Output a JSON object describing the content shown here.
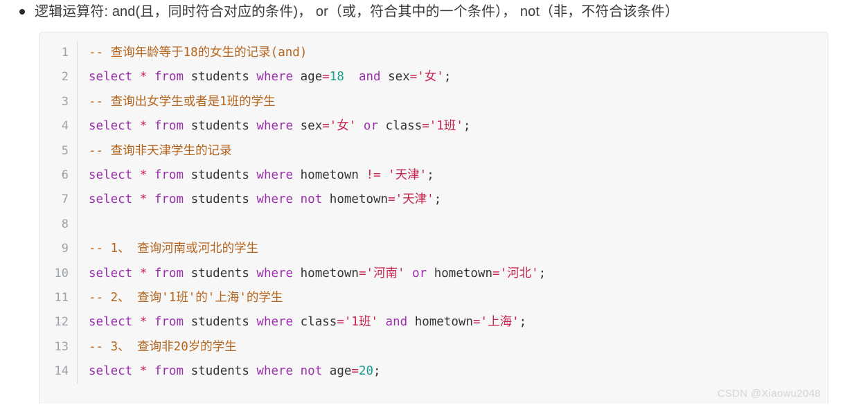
{
  "heading": {
    "bullet_icon": "bullet-dot-icon",
    "text": "逻辑运算符: and(且，同时符合对应的条件)， or（或，符合其中的一个条件）， not（非，不符合该条件）"
  },
  "code_block": {
    "language": "sql",
    "line_numbers": [
      "1",
      "2",
      "3",
      "4",
      "5",
      "6",
      "7",
      "8",
      "9",
      "10",
      "11",
      "12",
      "13",
      "14"
    ],
    "lines": [
      "-- 查询年龄等于18的女生的记录(and)",
      "select * from students where age=18  and sex='女';",
      "-- 查询出女学生或者是1班的学生",
      "select * from students where sex='女' or class='1班';",
      "-- 查询非天津学生的记录",
      "select * from students where hometown != '天津';",
      "select * from students where not hometown='天津';",
      "",
      "-- 1、 查询河南或河北的学生",
      "select * from students where hometown='河南' or hometown='河北';",
      "-- 2、 查询'1班'的'上海'的学生",
      "select * from students where class='1班' and hometown='上海';",
      "-- 3、 查询非20岁的学生",
      "select * from students where not age=20;"
    ],
    "colors": {
      "background": "#f7f7f8",
      "gutter_text": "#9aa2a8",
      "keyword": "#9b2fae",
      "string": "#c7254e",
      "operator": "#c7254e",
      "number": "#1a9c8c",
      "comment": "#b5651d",
      "identifier": "#333333"
    }
  },
  "watermark": {
    "text": "CSDN @Xiaowu2048"
  }
}
